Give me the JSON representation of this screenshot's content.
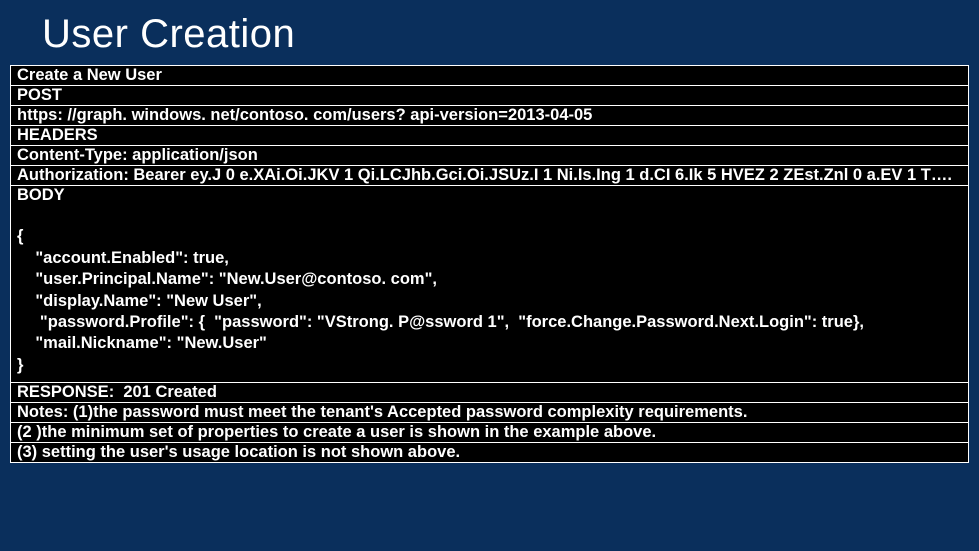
{
  "title": "User Creation",
  "request": {
    "heading": "Create a New User",
    "method": "POST",
    "url": "https: //graph. windows. net/contoso. com/users? api-version=2013-04-05",
    "headers_label": "HEADERS",
    "content_type": "Content-Type: application/json",
    "authorization": "Authorization: Bearer ey.J 0 e.XAi.Oi.JKV 1 Qi.LCJhb.Gci.Oi.JSUz.I 1 Ni.Is.Ing 1 d.CI 6.Ik 5 HVEZ 2 ZEst.Znl 0 a.EV 1 T….",
    "body_label": "BODY",
    "body_text": "\n{\n    \"account.Enabled\": true,\n    \"user.Principal.Name\": \"New.User@contoso. com\",\n    \"display.Name\": \"New User\",\n     \"password.Profile\": {  \"password\": \"VStrong. P@ssword 1\",  \"force.Change.Password.Next.Login\": true},\n    \"mail.Nickname\": \"New.User\"\n}\n"
  },
  "response": {
    "status": "RESPONSE:  201 Created",
    "note1": "Notes: (1)the password must meet the tenant's Accepted password complexity requirements.",
    "note2": "(2 )the minimum set of properties to create a user is shown in the example above.",
    "note3": "(3) setting the user's usage location is not shown above."
  }
}
